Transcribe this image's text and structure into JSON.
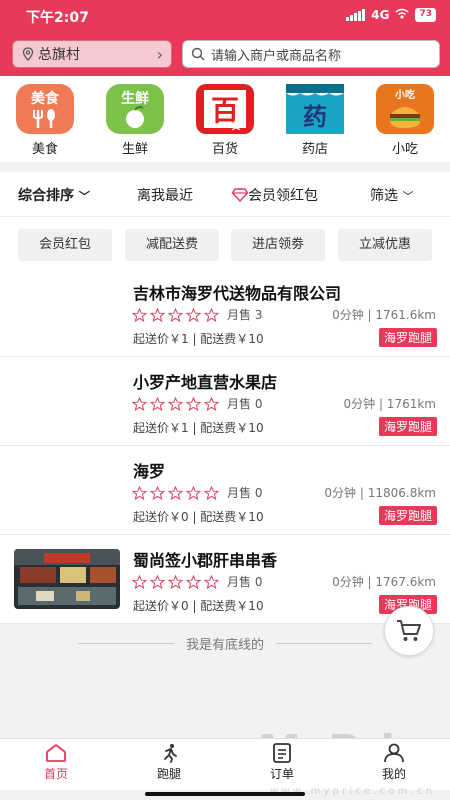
{
  "status": {
    "time": "下午2:07",
    "network": "4G",
    "battery": "73"
  },
  "header": {
    "location": "总旗村",
    "search_placeholder": "请输入商户或商品名称"
  },
  "categories": [
    {
      "label": "美食",
      "icon": "food-icon",
      "icon_text": "美食",
      "color": "#f07a55"
    },
    {
      "label": "生鲜",
      "icon": "fresh-produce-icon",
      "icon_text": "生鲜",
      "color": "#7cc24a"
    },
    {
      "label": "百货",
      "icon": "department-store-icon",
      "icon_text": "百",
      "color": "#e02020"
    },
    {
      "label": "药店",
      "icon": "pharmacy-icon",
      "icon_text": "药",
      "color": "#1aa4c8"
    },
    {
      "label": "小吃",
      "icon": "snack-icon",
      "icon_text": "小吃",
      "color": "#e8761f"
    }
  ],
  "sort": {
    "overall": "综合排序",
    "nearest": "离我最近",
    "member_coupon": "会员领红包",
    "filter": "筛选"
  },
  "filters": [
    "会员红包",
    "减配送费",
    "进店领劵",
    "立减优惠"
  ],
  "stores": [
    {
      "name": "吉林市海罗代送物品有限公司",
      "sold": "月售 3",
      "distance": "0分钟 | 1761.6km",
      "fee": "起送价￥1 | 配送费￥10",
      "tag": "海罗跑腿",
      "has_thumb": false
    },
    {
      "name": "小罗产地直营水果店",
      "sold": "月售 0",
      "distance": "0分钟 | 1761km",
      "fee": "起送价￥1 | 配送费￥10",
      "tag": "海罗跑腿",
      "has_thumb": false
    },
    {
      "name": "海罗",
      "sold": "月售 0",
      "distance": "0分钟 | 11806.8km",
      "fee": "起送价￥0 | 配送费￥10",
      "tag": "海罗跑腿",
      "has_thumb": false
    },
    {
      "name": "蜀尚签小郡肝串串香",
      "sold": "月售 0",
      "distance": "0分钟 | 1767.6km",
      "fee": "起送价￥0 | 配送费￥10",
      "tag": "海罗跑腿",
      "has_thumb": true
    }
  ],
  "end_text": "我是有底线的",
  "tabs": [
    {
      "label": "首页",
      "icon": "home-icon",
      "active": true
    },
    {
      "label": "跑腿",
      "icon": "runner-icon",
      "active": false
    },
    {
      "label": "订单",
      "icon": "order-icon",
      "active": false
    },
    {
      "label": "我的",
      "icon": "profile-icon",
      "active": false
    }
  ],
  "watermark": {
    "text": "MyPrice",
    "sub": "w w w . m y p r i c e . c o m . c n"
  },
  "colors": {
    "accent": "#e8395a",
    "tag": "#e8395a"
  }
}
